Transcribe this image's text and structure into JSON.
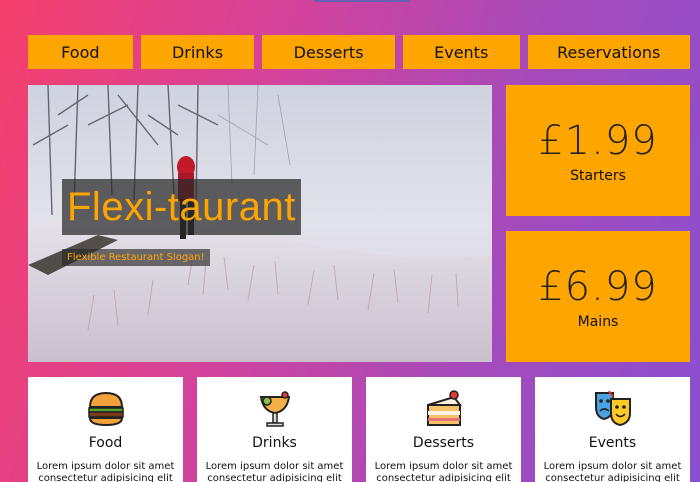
{
  "nav": {
    "items": [
      {
        "label": "Food"
      },
      {
        "label": "Drinks"
      },
      {
        "label": "Desserts"
      },
      {
        "label": "Events"
      },
      {
        "label": "Reservations"
      }
    ]
  },
  "hero": {
    "title": "Flexi-taurant",
    "slogan": "Flexible Restaurant Slogan!"
  },
  "prices": [
    {
      "price": "£1.99",
      "label": "Starters"
    },
    {
      "price": "£6.99",
      "label": "Mains"
    }
  ],
  "features": [
    {
      "title": "Food",
      "icon": "burger-icon",
      "desc": "Lorem ipsum dolor sit amet consectetur adipisicing elit"
    },
    {
      "title": "Drinks",
      "icon": "cocktail-icon",
      "desc": "Lorem ipsum dolor sit amet consectetur adipisicing elit"
    },
    {
      "title": "Desserts",
      "icon": "cake-icon",
      "desc": "Lorem ipsum dolor sit amet consectetur adipisicing elit"
    },
    {
      "title": "Events",
      "icon": "theater-masks-icon",
      "desc": "Lorem ipsum dolor sit amet consectetur adipisicing elit"
    }
  ],
  "colors": {
    "accent": "#ffa500",
    "gradient_start": "#f5406c",
    "gradient_end": "#8a4fd0"
  }
}
